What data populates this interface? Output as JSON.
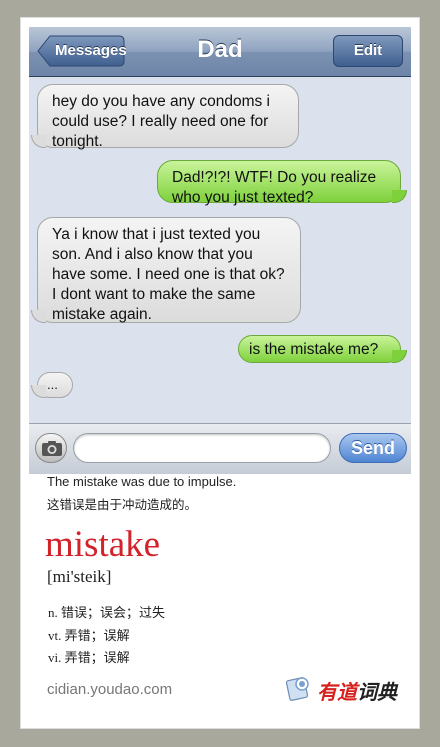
{
  "header": {
    "back_label": "Messages",
    "title": "Dad",
    "edit_label": "Edit"
  },
  "messages": [
    {
      "from": "received",
      "text": "hey do you have any condoms i could use? I really need one for tonight."
    },
    {
      "from": "sent",
      "text": "Dad!?!?! WTF! Do you realize who you just texted?"
    },
    {
      "from": "received",
      "text": "Ya i know that i just texted you son. And i also know that you have some. I need one is that ok? I dont want to make the same mistake again."
    },
    {
      "from": "sent",
      "text": "is the mistake me?"
    },
    {
      "from": "received",
      "text": "..."
    }
  ],
  "compose": {
    "placeholder": "",
    "send_label": "Send"
  },
  "dictionary": {
    "example_en": "The mistake was due to impulse.",
    "example_zh": "这错误是由于冲动造成的。",
    "word": "mistake",
    "phonetic": "[mi'steik]",
    "definitions": [
      "n. 错误；误会；过失",
      "vt. 弄错；误解",
      "vi. 弄错；误解"
    ],
    "site": "cidian.youdao.com",
    "logo_part1": "有道",
    "logo_part2": "词典"
  },
  "colors": {
    "sent_bubble": "#7fd13c",
    "received_bubble": "#dcdcdc",
    "headword": "#d2222a",
    "nav_bar": "#7c92b2"
  }
}
